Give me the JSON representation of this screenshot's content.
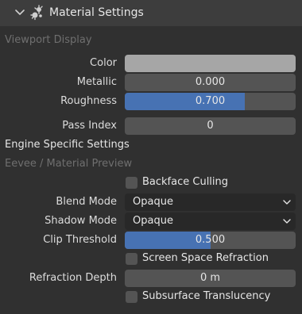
{
  "panel": {
    "title": "Material Settings",
    "chevron_icon": "chevron-down-icon",
    "panel_icon": "material-settings-icon"
  },
  "sections": {
    "viewport_display": "Viewport Display",
    "engine_specific": "Engine Specific Settings",
    "eevee_preview": "Eevee / Material Preview"
  },
  "viewport": {
    "color": {
      "label": "Color",
      "value_hex": "#a6a6a6"
    },
    "metallic": {
      "label": "Metallic",
      "value": "0.000",
      "fraction": 0.0
    },
    "roughness": {
      "label": "Roughness",
      "value": "0.700",
      "fraction": 0.7
    }
  },
  "pass_index": {
    "label": "Pass Index",
    "value": "0"
  },
  "eevee": {
    "backface_culling": {
      "label": "Backface Culling",
      "checked": false
    },
    "blend_mode": {
      "label": "Blend Mode",
      "value": "Opaque"
    },
    "shadow_mode": {
      "label": "Shadow Mode",
      "value": "Opaque"
    },
    "clip_threshold": {
      "label": "Clip Threshold",
      "value": "0.500",
      "fraction": 0.5
    },
    "screen_space_refraction": {
      "label": "Screen Space Refraction",
      "checked": false
    },
    "refraction_depth": {
      "label": "Refraction Depth",
      "value": "0 m"
    },
    "subsurface_translucency": {
      "label": "Subsurface Translucency",
      "checked": false
    }
  },
  "colors": {
    "accent_fill": "#4772b3",
    "field_bg": "#545454",
    "dropdown_bg": "#282828",
    "panel_bg": "#303030",
    "header_bg": "#3d3d3d"
  }
}
